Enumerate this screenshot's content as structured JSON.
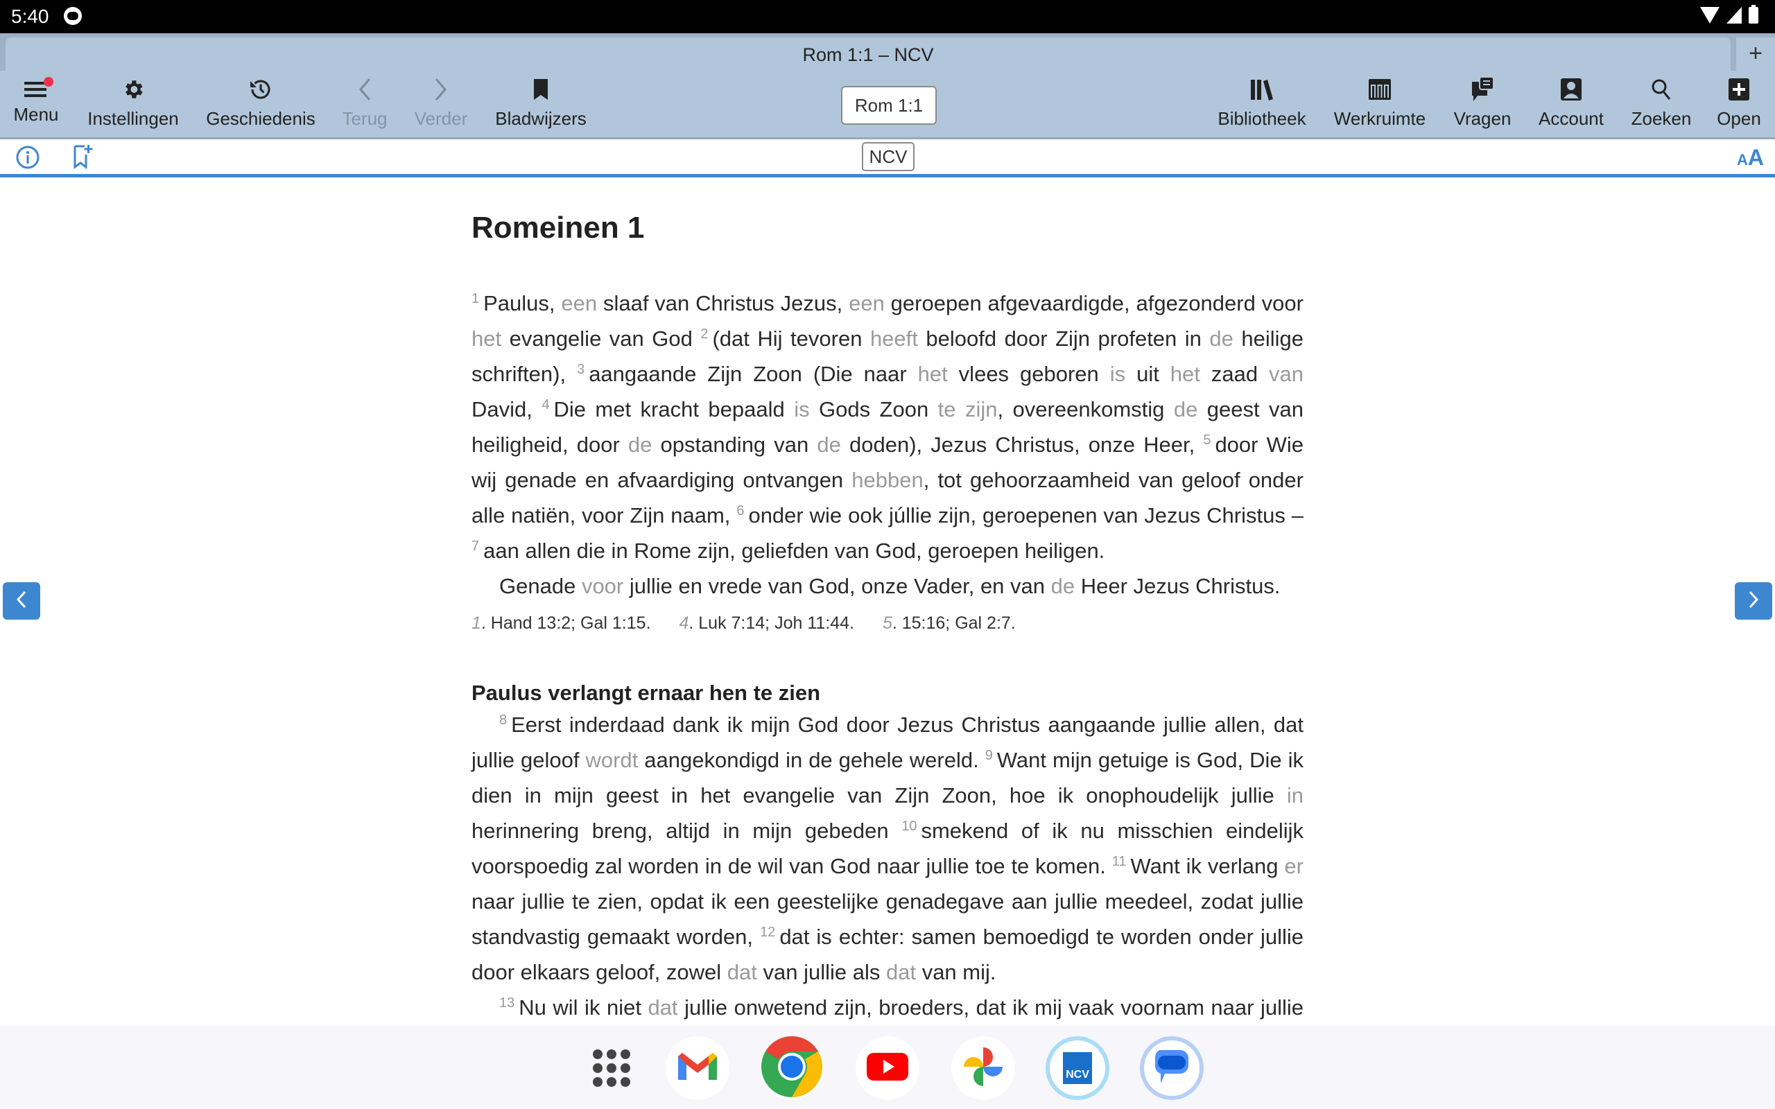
{
  "status_bar": {
    "time": "5:40"
  },
  "tab": {
    "title": "Rom 1:1 – NCV",
    "add_label": "+"
  },
  "toolbar": {
    "left": [
      {
        "id": "menu",
        "label": "Menu",
        "icon": "hamburger-icon",
        "badge": true
      },
      {
        "id": "instellingen",
        "label": "Instellingen",
        "icon": "gear-icon"
      },
      {
        "id": "geschiedenis",
        "label": "Geschiedenis",
        "icon": "history-icon"
      },
      {
        "id": "terug",
        "label": "Terug",
        "icon": "chevron-left-icon",
        "disabled": true
      },
      {
        "id": "verder",
        "label": "Verder",
        "icon": "chevron-right-icon",
        "disabled": true
      },
      {
        "id": "bladwijzers",
        "label": "Bladwijzers",
        "icon": "bookmark-icon"
      }
    ],
    "reference": "Rom 1:1",
    "right": [
      {
        "id": "bibliotheek",
        "label": "Bibliotheek",
        "icon": "library-icon"
      },
      {
        "id": "werkruimte",
        "label": "Werkruimte",
        "icon": "workspace-icon"
      },
      {
        "id": "vragen",
        "label": "Vragen",
        "icon": "chat-icon"
      },
      {
        "id": "account",
        "label": "Account",
        "icon": "account-icon"
      },
      {
        "id": "zoeken",
        "label": "Zoeken",
        "icon": "search-icon"
      },
      {
        "id": "open",
        "label": "Open",
        "icon": "plus-box-icon"
      }
    ]
  },
  "subbar": {
    "version": "NCV",
    "font_small": "A",
    "font_big": "A"
  },
  "content": {
    "chapter_title": "Romeinen 1",
    "section_heading": "Paulus verlangt ernaar hen te zien",
    "footnotes": [
      {
        "num": "1",
        "text": ". Hand 13:2; Gal 1:15."
      },
      {
        "num": "4",
        "text": ". Luk 7:14; Joh 11:44."
      },
      {
        "num": "5",
        "text": ". 15:16; Gal 2:7."
      }
    ]
  },
  "colors": {
    "toolbar": "#b1c6da",
    "accent": "#3d87d0",
    "added_word": "#9a9a9a",
    "badge": "#e8334f"
  },
  "dock": {
    "apps": [
      {
        "id": "app-drawer",
        "name": "Apps"
      },
      {
        "id": "gmail",
        "name": "Gmail"
      },
      {
        "id": "chrome",
        "name": "Chrome"
      },
      {
        "id": "youtube",
        "name": "YouTube"
      },
      {
        "id": "photos",
        "name": "Foto's"
      },
      {
        "id": "ncv",
        "name": "NCV",
        "label": "NCV"
      },
      {
        "id": "messages",
        "name": "Berichten"
      }
    ]
  }
}
